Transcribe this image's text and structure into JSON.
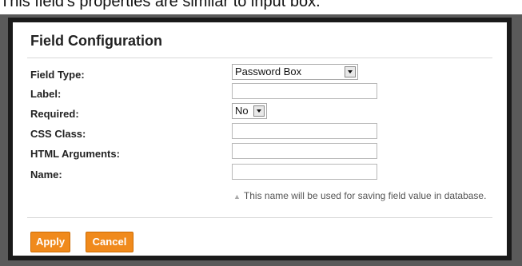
{
  "background": {
    "caption": "This field's properties are similar to input box."
  },
  "dialog": {
    "title": "Field Configuration",
    "fields": {
      "field_type": {
        "label": "Field Type:",
        "value": "Password Box"
      },
      "label": {
        "label": "Label:",
        "value": ""
      },
      "required": {
        "label": "Required:",
        "value": "No"
      },
      "css_class": {
        "label": "CSS Class:",
        "value": ""
      },
      "html_arguments": {
        "label": "HTML Arguments:",
        "value": ""
      },
      "name": {
        "label": "Name:",
        "value": ""
      }
    },
    "name_hint": "This name will be used for saving field value in database.",
    "apply_label": "Apply",
    "cancel_label": "Cancel"
  },
  "colors": {
    "button_orange": "#f08a1c",
    "backdrop": "#5a5a5a"
  },
  "icons": [
    "dropdown-arrow-icon",
    "hint-triangle-icon"
  ]
}
